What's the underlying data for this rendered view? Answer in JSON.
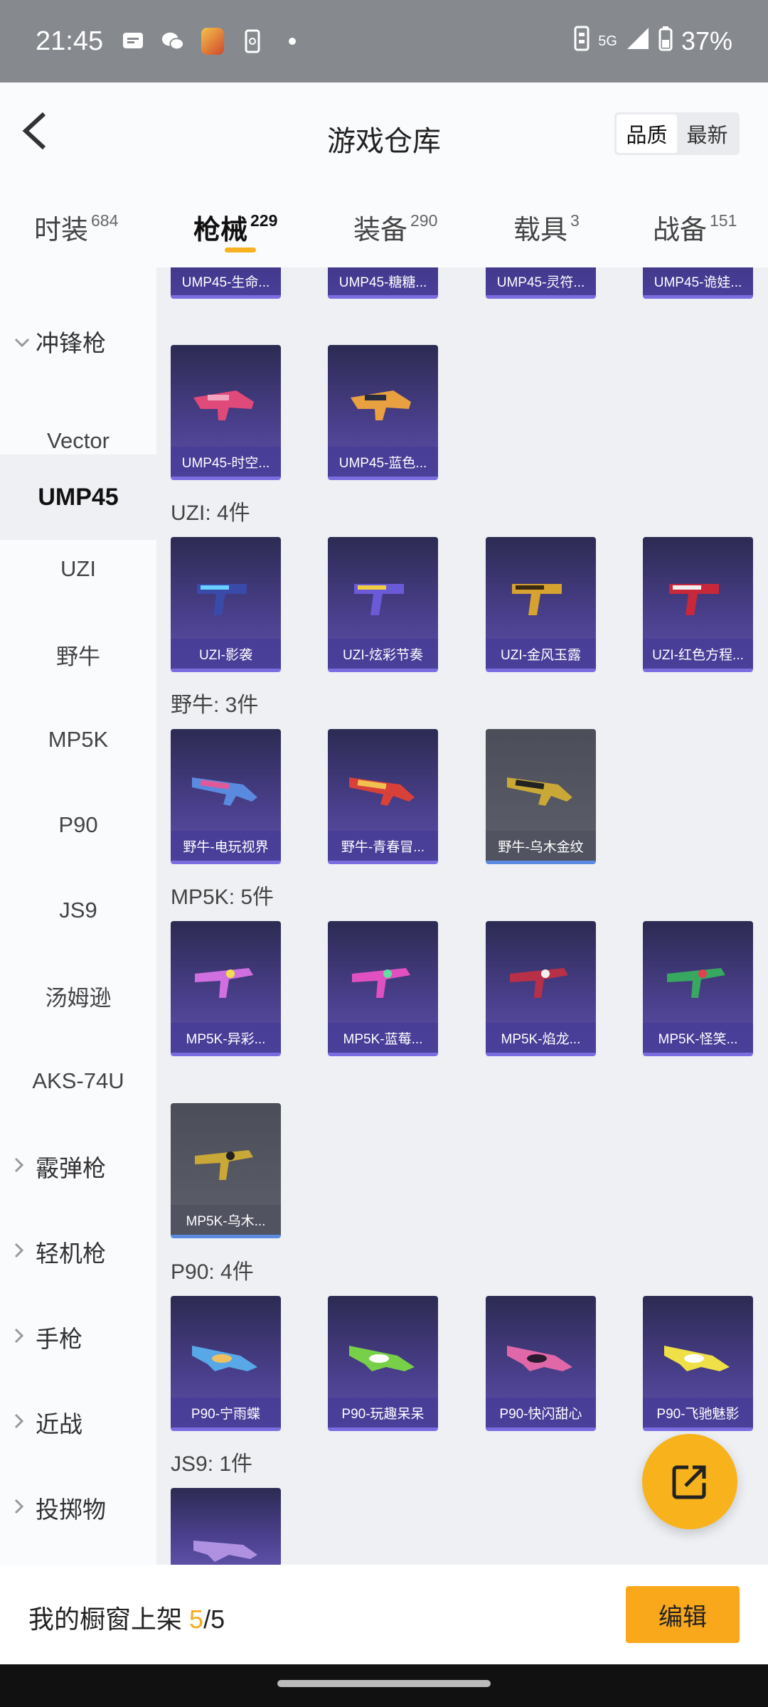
{
  "status": {
    "time": "21:45",
    "network": "5G",
    "battery": "37%"
  },
  "header": {
    "title": "游戏仓库",
    "sort_quality": "品质",
    "sort_newest": "最新"
  },
  "tabs": [
    {
      "label": "时装",
      "count": "684"
    },
    {
      "label": "枪械",
      "count": "229"
    },
    {
      "label": "装备",
      "count": "290"
    },
    {
      "label": "载具",
      "count": "3"
    },
    {
      "label": "战备",
      "count": "151"
    }
  ],
  "sidebar": {
    "smg": "冲锋枪",
    "items": [
      "Vector",
      "UMP45",
      "UZI",
      "野牛",
      "MP5K",
      "P90",
      "JS9",
      "汤姆逊",
      "AKS-74U"
    ],
    "categories": [
      "霰弹枪",
      "轻机枪",
      "手枪",
      "近战",
      "投掷物"
    ]
  },
  "groups": {
    "ump45_partial": [
      "UMP45-生命...",
      "UMP45-糖糖...",
      "UMP45-灵符...",
      "UMP45-诡娃..."
    ],
    "ump45_more": [
      "UMP45-时空...",
      "UMP45-蓝色..."
    ],
    "uzi_title": "UZI: 4件",
    "uzi": [
      "UZI-影袭",
      "UZI-炫彩节奏",
      "UZI-金风玉露",
      "UZI-红色方程..."
    ],
    "bison_title": "野牛: 3件",
    "bison": [
      "野牛-电玩视界",
      "野牛-青春冒...",
      "野牛-乌木金纹"
    ],
    "mp5k_title": "MP5K: 5件",
    "mp5k": [
      "MP5K-异彩...",
      "MP5K-蓝莓...",
      "MP5K-焰龙...",
      "MP5K-怪笑...",
      "MP5K-乌木..."
    ],
    "p90_title": "P90: 4件",
    "p90": [
      "P90-宁雨蝶",
      "P90-玩趣呆呆",
      "P90-快闪甜心",
      "P90-飞驰魅影"
    ],
    "js9_title": "JS9: 1件"
  },
  "bottom": {
    "shelf_label": "我的橱窗上架",
    "shelf_current": "5",
    "shelf_total": "/5",
    "edit_label": "编辑"
  },
  "colors": {
    "accent": "#f8b21b",
    "card_purple": "#4a3f8c",
    "card_gray": "#5d5f6b"
  }
}
